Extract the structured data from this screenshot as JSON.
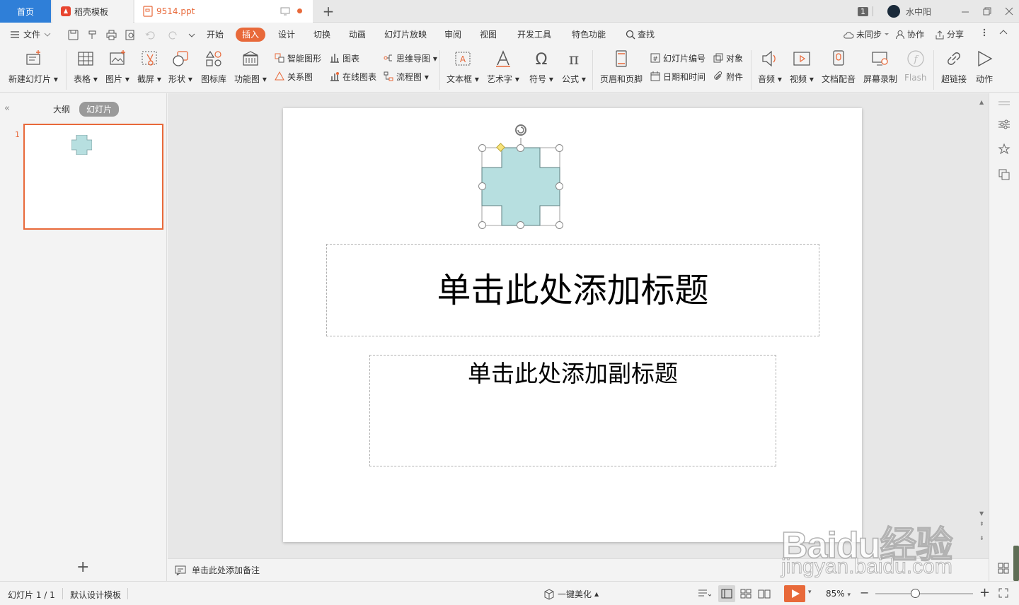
{
  "tabs": {
    "home": "首页",
    "template": "稻壳模板",
    "doc": "9514.ppt",
    "add": "+"
  },
  "titlebar": {
    "window_count": "1",
    "user": "水中阳"
  },
  "menu": {
    "file": "文件",
    "items": [
      "开始",
      "插入",
      "设计",
      "切换",
      "动画",
      "幻灯片放映",
      "审阅",
      "视图",
      "开发工具",
      "特色功能"
    ],
    "search": "查找",
    "sync": "未同步",
    "collab": "协作",
    "share": "分享"
  },
  "ribbon": {
    "new_slide": "新建幻灯片",
    "table": "表格",
    "picture": "图片",
    "screenshot": "截屏",
    "shape": "形状",
    "icon_lib": "图标库",
    "func_chart": "功能图",
    "smart_shape": "智能图形",
    "chart": "图表",
    "relation": "关系图",
    "online_chart": "在线图表",
    "mindmap": "思维导图",
    "flowchart": "流程图",
    "textbox": "文本框",
    "wordart": "艺术字",
    "symbol": "符号",
    "formula": "公式",
    "header_footer": "页眉和页脚",
    "slide_number": "幻灯片编号",
    "object": "对象",
    "date_time": "日期和时间",
    "attachment": "附件",
    "audio": "音频",
    "video": "视频",
    "doc_voice": "文档配音",
    "screen_record": "屏幕录制",
    "flash": "Flash",
    "hyperlink": "超链接",
    "action": "动作"
  },
  "panel": {
    "outline": "大纲",
    "slides": "幻灯片",
    "slide_number": "1",
    "add": "+"
  },
  "slide": {
    "title_placeholder": "单击此处添加标题",
    "subtitle_placeholder": "单击此处添加副标题"
  },
  "notes": {
    "placeholder": "单击此处添加备注"
  },
  "status": {
    "slide_info": "幻灯片 1 / 1",
    "theme": "默认设计模板",
    "beautify": "一键美化",
    "zoom": "85%"
  },
  "watermark": {
    "logo": "Baidu经验",
    "url": "jingyan.baidu.com"
  },
  "colors": {
    "accent": "#e8693a",
    "home_tab": "#2f7fd8",
    "shape_fill": "#b7dfe0",
    "selection_border": "#e8693a"
  }
}
